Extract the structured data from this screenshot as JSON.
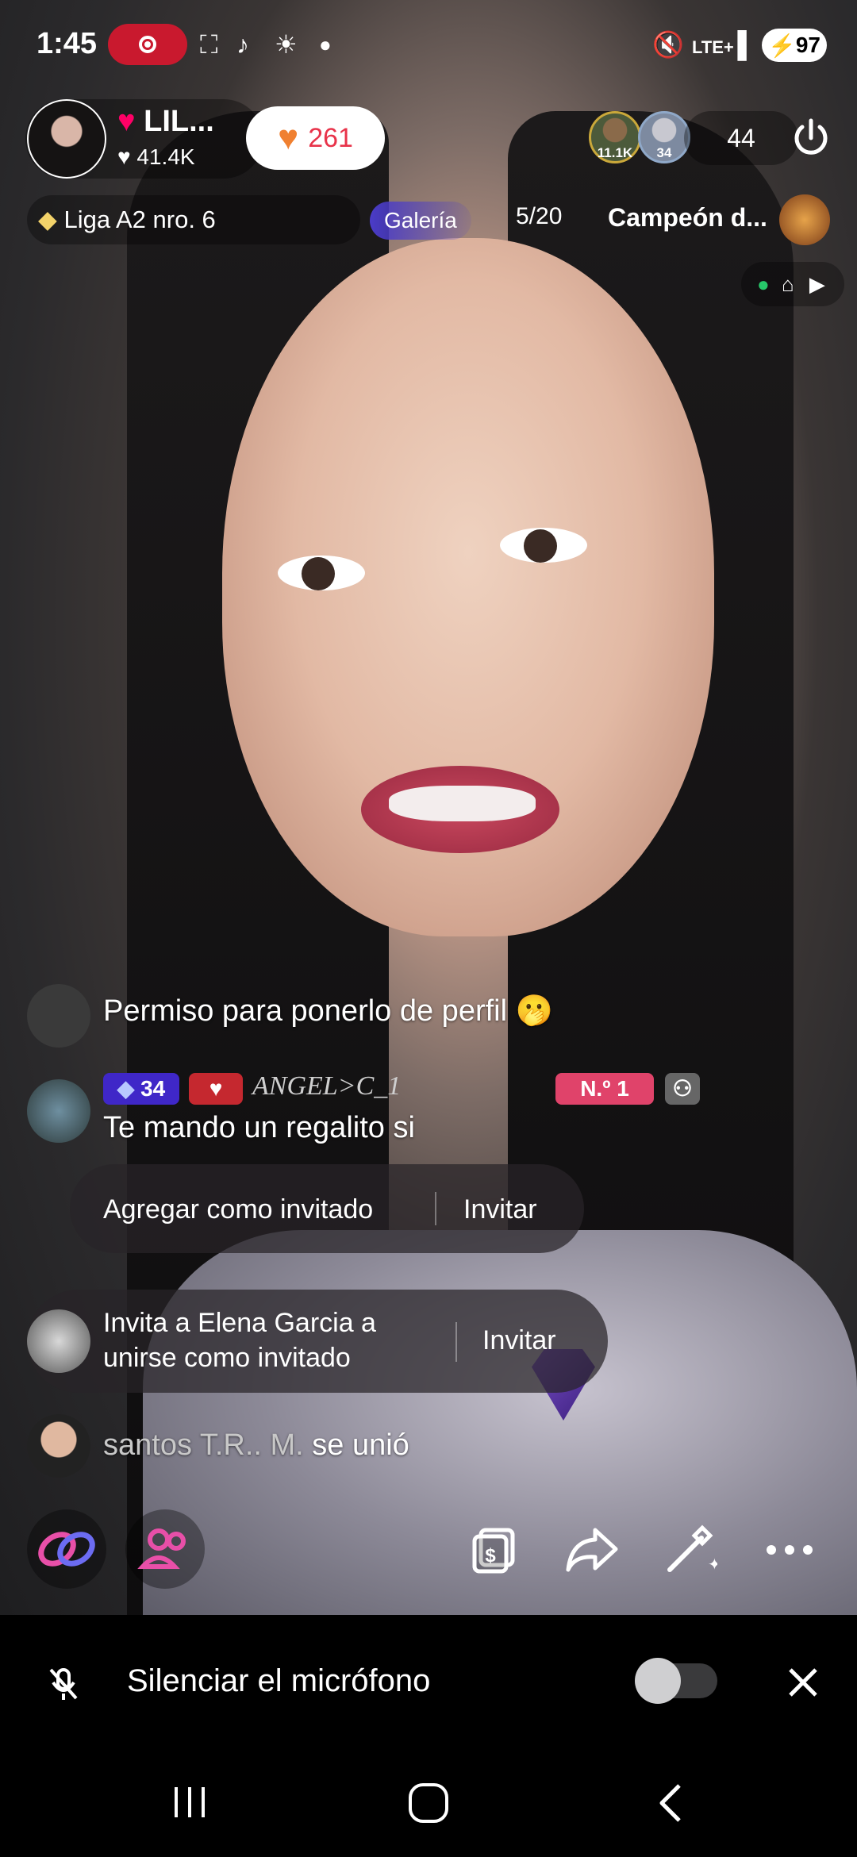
{
  "status_bar": {
    "time": "1:45",
    "network": "LTE+",
    "battery": "97"
  },
  "host": {
    "name": "LIL...",
    "likes": "41.4K",
    "like_count": "261"
  },
  "viewers": {
    "viewer1_badge": "11.1K",
    "viewer2_badge": "34",
    "count": "44"
  },
  "league": {
    "label": "Liga A2 nro. 6"
  },
  "gallery": {
    "label": "Galería",
    "progress": "5/20"
  },
  "campeon": {
    "label": "Campeón d..."
  },
  "chat": {
    "message1": "Permiso para ponerlo de perfil 🫢",
    "message2_user": "ANGEL>C_1",
    "message2_level": "34",
    "message2_rank": "N.º 1",
    "message2_text": "Te mando un regalito si",
    "message3_user": "santos T.R.. M.",
    "message3_text": "se unió"
  },
  "actions": {
    "add_guest": "Agregar como invitado",
    "invite": "Invitar",
    "invite_prompt_line1": "Invita a Elena  Garcia a",
    "invite_prompt_line2": "unirse como invitado",
    "invite2": "Invitar"
  },
  "mic_bar": {
    "label": "Silenciar el micrófono",
    "muted": false
  },
  "colors": {
    "accent_red": "#e8334a",
    "record": "#c9192e",
    "like_heart": "#f08030",
    "galeria": "#4b3cc9"
  }
}
